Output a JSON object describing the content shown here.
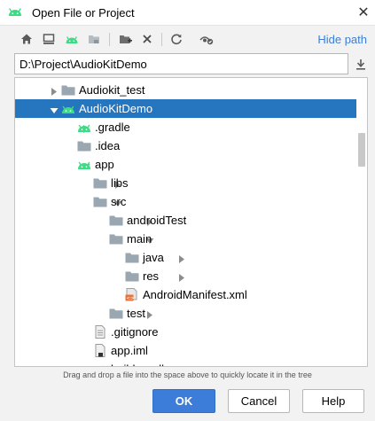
{
  "window": {
    "title": "Open File or Project",
    "close_icon": "close-icon"
  },
  "toolbar": {
    "icons": [
      "home-icon",
      "desktop-icon",
      "android-project-icon",
      "module-icon",
      "new-folder-icon",
      "delete-icon",
      "refresh-icon",
      "show-hidden-icon"
    ],
    "hide_path_label": "Hide path"
  },
  "path": {
    "value": "D:\\Project\\AudioKitDemo"
  },
  "tree": {
    "items": [
      {
        "label": "Audiokit_test",
        "icon": "folder",
        "expanded": false,
        "selected": false
      },
      {
        "label": "AudioKitDemo",
        "icon": "android",
        "expanded": true,
        "selected": true
      },
      {
        "label": ".gradle",
        "icon": "android",
        "expanded": false,
        "selected": false
      },
      {
        "label": ".idea",
        "icon": "folder",
        "expanded": false,
        "selected": false
      },
      {
        "label": "app",
        "icon": "android",
        "expanded": true,
        "selected": false
      },
      {
        "label": "libs",
        "icon": "folder",
        "expanded": false,
        "selected": false
      },
      {
        "label": "src",
        "icon": "folder",
        "expanded": true,
        "selected": false
      },
      {
        "label": "androidTest",
        "icon": "folder",
        "expanded": false,
        "selected": false
      },
      {
        "label": "main",
        "icon": "folder",
        "expanded": true,
        "selected": false
      },
      {
        "label": "java",
        "icon": "folder",
        "expanded": false,
        "selected": false
      },
      {
        "label": "res",
        "icon": "folder",
        "expanded": false,
        "selected": false
      },
      {
        "label": "AndroidManifest.xml",
        "icon": "xml-file",
        "expanded": null,
        "selected": false
      },
      {
        "label": "test",
        "icon": "folder",
        "expanded": false,
        "selected": false
      },
      {
        "label": ".gitignore",
        "icon": "text-file",
        "expanded": null,
        "selected": false
      },
      {
        "label": "app.iml",
        "icon": "iml-file",
        "expanded": null,
        "selected": false
      },
      {
        "label": "build.gradle",
        "icon": "gradle-file",
        "expanded": null,
        "selected": false
      }
    ]
  },
  "hint": "Drag and drop a file into the space above to quickly locate it in the tree",
  "buttons": {
    "ok": "OK",
    "cancel": "Cancel",
    "help": "Help"
  },
  "colors": {
    "selection": "#2675bf",
    "android_green": "#3ddc84",
    "folder": "#9aa7b0",
    "link": "#3d7ed6",
    "primary_button": "#3b7dd8"
  }
}
